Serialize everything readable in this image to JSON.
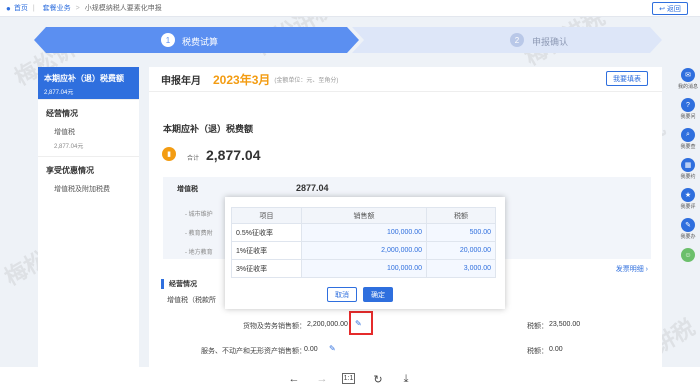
{
  "topbar": {
    "home": "首页",
    "biz": "套餐业务",
    "current": "小规模纳税人要素化申报",
    "back": "返回"
  },
  "steps": [
    {
      "num": "1",
      "label": "税费试算"
    },
    {
      "num": "2",
      "label": "申报确认"
    }
  ],
  "leftnav": {
    "active_title": "本期应补（退）税费额",
    "active_sub": "2,877.04元",
    "sec1": "经营情况",
    "item1": "增值税",
    "item1_sub": "2,877.04元",
    "sec2": "享受优惠情况",
    "item2": "增值税及附加税费"
  },
  "main": {
    "period_label": "申报年月",
    "period": "2023年3月",
    "unit": "(金额单位：元、至角分)",
    "fill_btn": "我要填表",
    "section_title": "本期应补（退）税费额",
    "total_label": "合计",
    "total_value": "2,877.04",
    "vat_label": "增值税",
    "vat_value": "2877.04",
    "sub1": "- 城市维护",
    "sub2": "- 教育费附",
    "sub3": "- 地方教育",
    "biz_title": "经营情况",
    "vat_row": "增值税（税款所",
    "invoice_link": "发票明细",
    "row1_label": "货物及劳务销售额：",
    "row1_value": "2,200,000.00",
    "row1_tax_label": "税额：",
    "row1_tax": "23,500.00",
    "row2_label": "服务、不动产和无形资产销售额：",
    "row2_value": "0.00",
    "row2_tax_label": "税额：",
    "row2_tax": "0.00"
  },
  "modal": {
    "headers": [
      "项目",
      "销售额",
      "税额"
    ],
    "rows": [
      {
        "item": "0.5%征收率",
        "sales": "100,000.00",
        "tax": "500.00"
      },
      {
        "item": "1%征收率",
        "sales": "2,000,000.00",
        "tax": "20,000.00"
      },
      {
        "item": "3%征收率",
        "sales": "100,000.00",
        "tax": "3,000.00"
      }
    ],
    "cancel": "取消",
    "ok": "确定"
  },
  "rightbar": [
    "我的消息",
    "我要问",
    "我要查",
    "我要约",
    "我要评",
    "我要办"
  ],
  "watermark": "梅松讲税"
}
